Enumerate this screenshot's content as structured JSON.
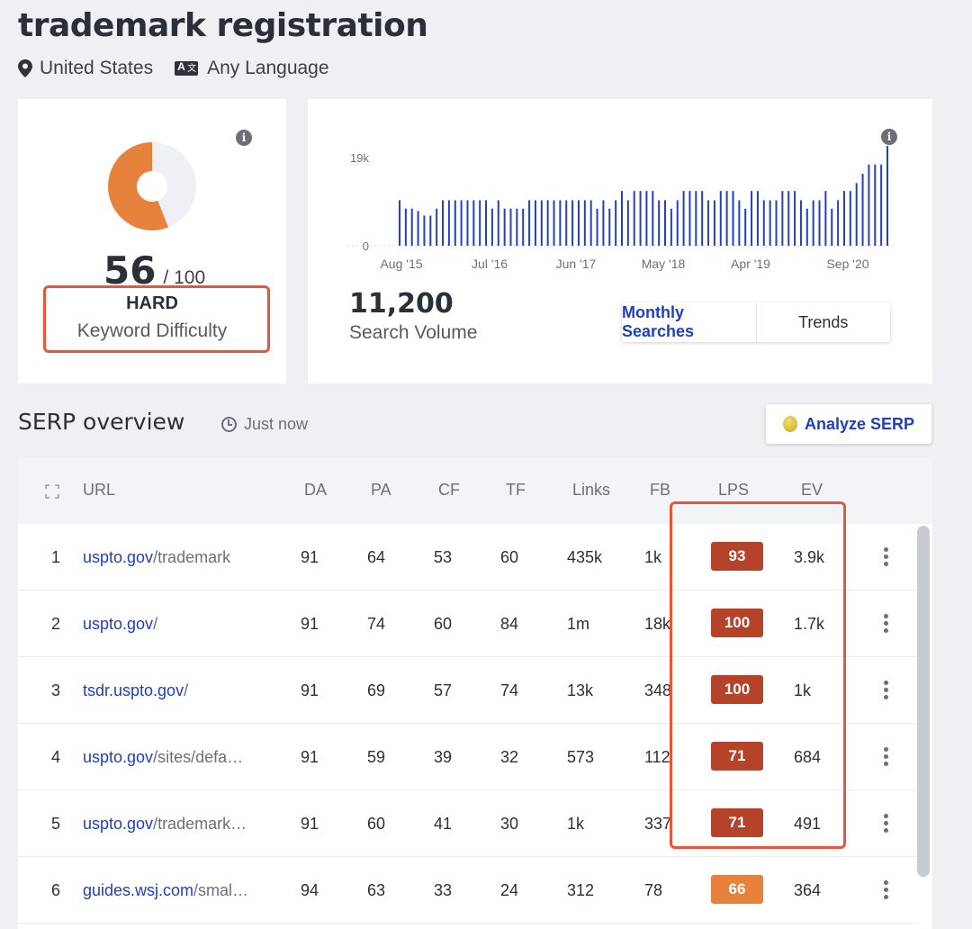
{
  "header": {
    "keyword": "trademark registration",
    "location": "United States",
    "language": "Any Language",
    "location_icon": "map-pin-icon",
    "language_icon": "translate-icon"
  },
  "keyword_difficulty": {
    "score": "56",
    "max": "/ 100",
    "score_value": 56,
    "level": "HARD",
    "label": "Keyword Difficulty",
    "gauge_color": "#e6823c",
    "highlight_color": "#e8553b"
  },
  "search_volume": {
    "value": "11,200",
    "label": "Search Volume",
    "tabs": [
      {
        "label": "Monthly Searches",
        "active": true
      },
      {
        "label": "Trends",
        "active": false
      }
    ]
  },
  "chart_data": {
    "type": "bar",
    "title": "",
    "xlabel": "",
    "ylabel": "",
    "y_tick_labels": [
      "19k",
      "0"
    ],
    "ylim": [
      0,
      19000
    ],
    "x_tick_labels": [
      "Aug '15",
      "Jul '16",
      "Jun '17",
      "May '18",
      "Apr '19",
      "Sep '20"
    ],
    "bar_color": "#2441b5",
    "values": [
      9800,
      8000,
      8000,
      7500,
      6500,
      6500,
      8000,
      9800,
      9800,
      9800,
      9800,
      9800,
      9800,
      9800,
      9800,
      8000,
      9800,
      8000,
      8000,
      8000,
      8000,
      9800,
      9800,
      9800,
      9800,
      9800,
      9800,
      9800,
      9800,
      9800,
      9800,
      9800,
      8000,
      9800,
      8000,
      9800,
      11800,
      9800,
      11800,
      11800,
      11800,
      11800,
      9800,
      9800,
      8000,
      9800,
      11800,
      11800,
      11800,
      11800,
      9800,
      9800,
      11800,
      11800,
      11800,
      9800,
      8000,
      11800,
      11800,
      9800,
      9800,
      9800,
      11800,
      11800,
      11800,
      9800,
      8000,
      9800,
      9800,
      11800,
      8000,
      9800,
      11800,
      11800,
      13500,
      15500,
      17500,
      17500,
      17500,
      21500
    ]
  },
  "serp": {
    "title": "SERP overview",
    "time": "Just now",
    "analyze_label": "Analyze SERP",
    "columns": [
      "URL",
      "DA",
      "PA",
      "CF",
      "TF",
      "Links",
      "FB",
      "LPS",
      "EV"
    ],
    "rows": [
      {
        "rank": "1",
        "domain": "uspto.gov",
        "path": "/trademark",
        "da": "91",
        "pa": "64",
        "cf": "53",
        "tf": "60",
        "links": "435k",
        "fb": "1k",
        "lps": "93",
        "lps_color": "#b5432a",
        "ev": "3.9k"
      },
      {
        "rank": "2",
        "domain": "uspto.gov",
        "path": "/",
        "da": "91",
        "pa": "74",
        "cf": "60",
        "tf": "84",
        "links": "1m",
        "fb": "18k",
        "lps": "100",
        "lps_color": "#b5432a",
        "ev": "1.7k"
      },
      {
        "rank": "3",
        "domain": "tsdr.uspto.gov",
        "path": "/",
        "da": "91",
        "pa": "69",
        "cf": "57",
        "tf": "74",
        "links": "13k",
        "fb": "348",
        "lps": "100",
        "lps_color": "#b5432a",
        "ev": "1k"
      },
      {
        "rank": "4",
        "domain": "uspto.gov",
        "path": "/sites/defa…",
        "da": "91",
        "pa": "59",
        "cf": "39",
        "tf": "32",
        "links": "573",
        "fb": "112",
        "lps": "71",
        "lps_color": "#b5432a",
        "ev": "684"
      },
      {
        "rank": "5",
        "domain": "uspto.gov",
        "path": "/trademark…",
        "da": "91",
        "pa": "60",
        "cf": "41",
        "tf": "30",
        "links": "1k",
        "fb": "337",
        "lps": "71",
        "lps_color": "#b5432a",
        "ev": "491"
      },
      {
        "rank": "6",
        "domain": "guides.wsj.com",
        "path": "/smal…",
        "da": "94",
        "pa": "63",
        "cf": "33",
        "tf": "24",
        "links": "312",
        "fb": "78",
        "lps": "66",
        "lps_color": "#e6823c",
        "ev": "364"
      }
    ]
  }
}
